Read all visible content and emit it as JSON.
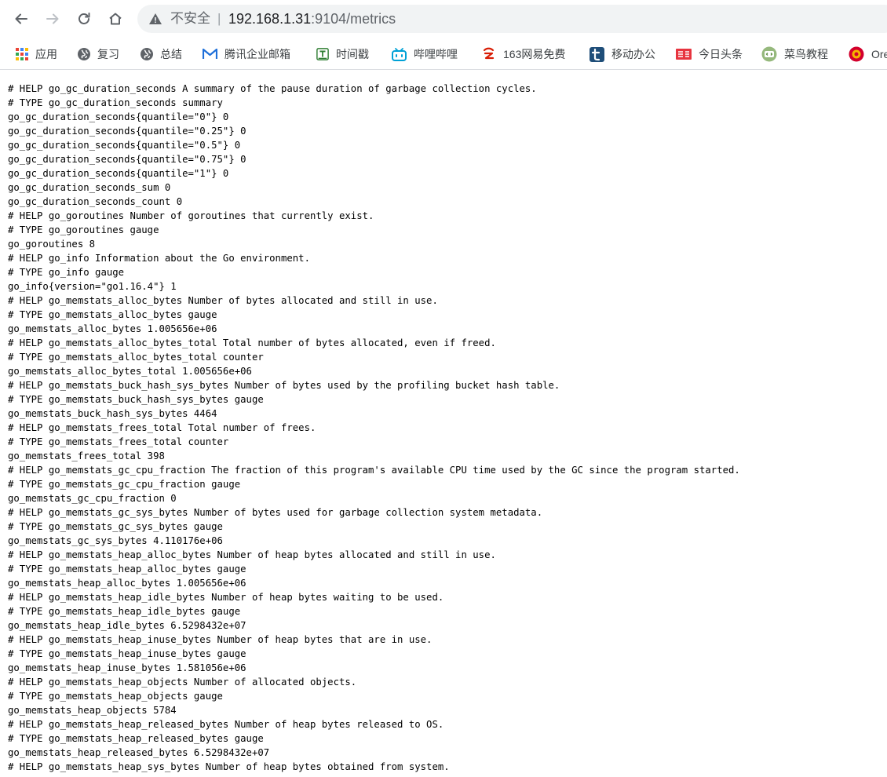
{
  "browser": {
    "address_bar": {
      "security_label": "不安全",
      "separator": "|",
      "host": "192.168.1.31",
      "path": ":9104/metrics"
    }
  },
  "bookmarks": [
    {
      "label": "应用",
      "icon": "apps-grid-icon"
    },
    {
      "label": "复习",
      "icon": "globe-icon"
    },
    {
      "label": "总结",
      "icon": "globe-icon"
    },
    {
      "label": "腾讯企业邮箱",
      "icon": "tencent-mail-icon"
    },
    {
      "label": "时间戳",
      "icon": "timestamp-tool-icon"
    },
    {
      "label": "哔哩哔哩",
      "icon": "bilibili-icon"
    },
    {
      "label": "163网易免费",
      "icon": "netease-163-icon"
    },
    {
      "label": "移动办公",
      "icon": "t-letter-icon"
    },
    {
      "label": "今日头条",
      "icon": "toutiao-icon"
    },
    {
      "label": "菜鸟教程",
      "icon": "runoob-icon"
    },
    {
      "label": "Ore",
      "icon": "oreilly-icon"
    }
  ],
  "metrics_text": [
    "# HELP go_gc_duration_seconds A summary of the pause duration of garbage collection cycles.",
    "# TYPE go_gc_duration_seconds summary",
    "go_gc_duration_seconds{quantile=\"0\"} 0",
    "go_gc_duration_seconds{quantile=\"0.25\"} 0",
    "go_gc_duration_seconds{quantile=\"0.5\"} 0",
    "go_gc_duration_seconds{quantile=\"0.75\"} 0",
    "go_gc_duration_seconds{quantile=\"1\"} 0",
    "go_gc_duration_seconds_sum 0",
    "go_gc_duration_seconds_count 0",
    "# HELP go_goroutines Number of goroutines that currently exist.",
    "# TYPE go_goroutines gauge",
    "go_goroutines 8",
    "# HELP go_info Information about the Go environment.",
    "# TYPE go_info gauge",
    "go_info{version=\"go1.16.4\"} 1",
    "# HELP go_memstats_alloc_bytes Number of bytes allocated and still in use.",
    "# TYPE go_memstats_alloc_bytes gauge",
    "go_memstats_alloc_bytes 1.005656e+06",
    "# HELP go_memstats_alloc_bytes_total Total number of bytes allocated, even if freed.",
    "# TYPE go_memstats_alloc_bytes_total counter",
    "go_memstats_alloc_bytes_total 1.005656e+06",
    "# HELP go_memstats_buck_hash_sys_bytes Number of bytes used by the profiling bucket hash table.",
    "# TYPE go_memstats_buck_hash_sys_bytes gauge",
    "go_memstats_buck_hash_sys_bytes 4464",
    "# HELP go_memstats_frees_total Total number of frees.",
    "# TYPE go_memstats_frees_total counter",
    "go_memstats_frees_total 398",
    "# HELP go_memstats_gc_cpu_fraction The fraction of this program's available CPU time used by the GC since the program started.",
    "# TYPE go_memstats_gc_cpu_fraction gauge",
    "go_memstats_gc_cpu_fraction 0",
    "# HELP go_memstats_gc_sys_bytes Number of bytes used for garbage collection system metadata.",
    "# TYPE go_memstats_gc_sys_bytes gauge",
    "go_memstats_gc_sys_bytes 4.110176e+06",
    "# HELP go_memstats_heap_alloc_bytes Number of heap bytes allocated and still in use.",
    "# TYPE go_memstats_heap_alloc_bytes gauge",
    "go_memstats_heap_alloc_bytes 1.005656e+06",
    "# HELP go_memstats_heap_idle_bytes Number of heap bytes waiting to be used.",
    "# TYPE go_memstats_heap_idle_bytes gauge",
    "go_memstats_heap_idle_bytes 6.5298432e+07",
    "# HELP go_memstats_heap_inuse_bytes Number of heap bytes that are in use.",
    "# TYPE go_memstats_heap_inuse_bytes gauge",
    "go_memstats_heap_inuse_bytes 1.581056e+06",
    "# HELP go_memstats_heap_objects Number of allocated objects.",
    "# TYPE go_memstats_heap_objects gauge",
    "go_memstats_heap_objects 5784",
    "# HELP go_memstats_heap_released_bytes Number of heap bytes released to OS.",
    "# TYPE go_memstats_heap_released_bytes gauge",
    "go_memstats_heap_released_bytes 6.5298432e+07",
    "# HELP go_memstats_heap_sys_bytes Number of heap bytes obtained from system."
  ]
}
